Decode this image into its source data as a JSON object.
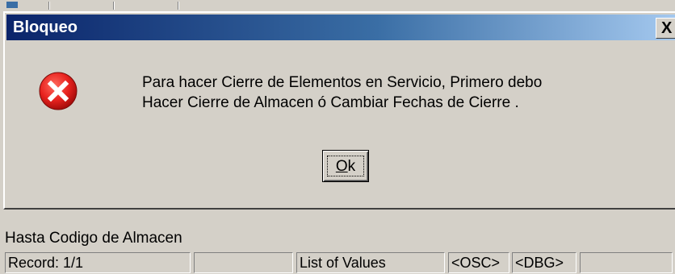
{
  "dialog": {
    "title": "Bloqueo",
    "close_label": "X",
    "icon": "error-icon",
    "message_line1": "Para hacer Cierre de Elementos en Servicio, Primero debo",
    "message_line2": "Hacer Cierre de Almacen ó Cambiar Fechas de Cierre .",
    "ok_label": "Ok"
  },
  "status": {
    "hint": "Hasta Codigo de Almacen",
    "record": "Record: 1/1",
    "field2": "",
    "list_of_values": "List of Values",
    "osc": "<OSC>",
    "dbg": "<DBG>",
    "field6": ""
  },
  "colors": {
    "title_gradient_start": "#0a246a",
    "title_gradient_end": "#a6caf0",
    "error_red": "#e8231f",
    "window_bg": "#d4d0c8"
  }
}
